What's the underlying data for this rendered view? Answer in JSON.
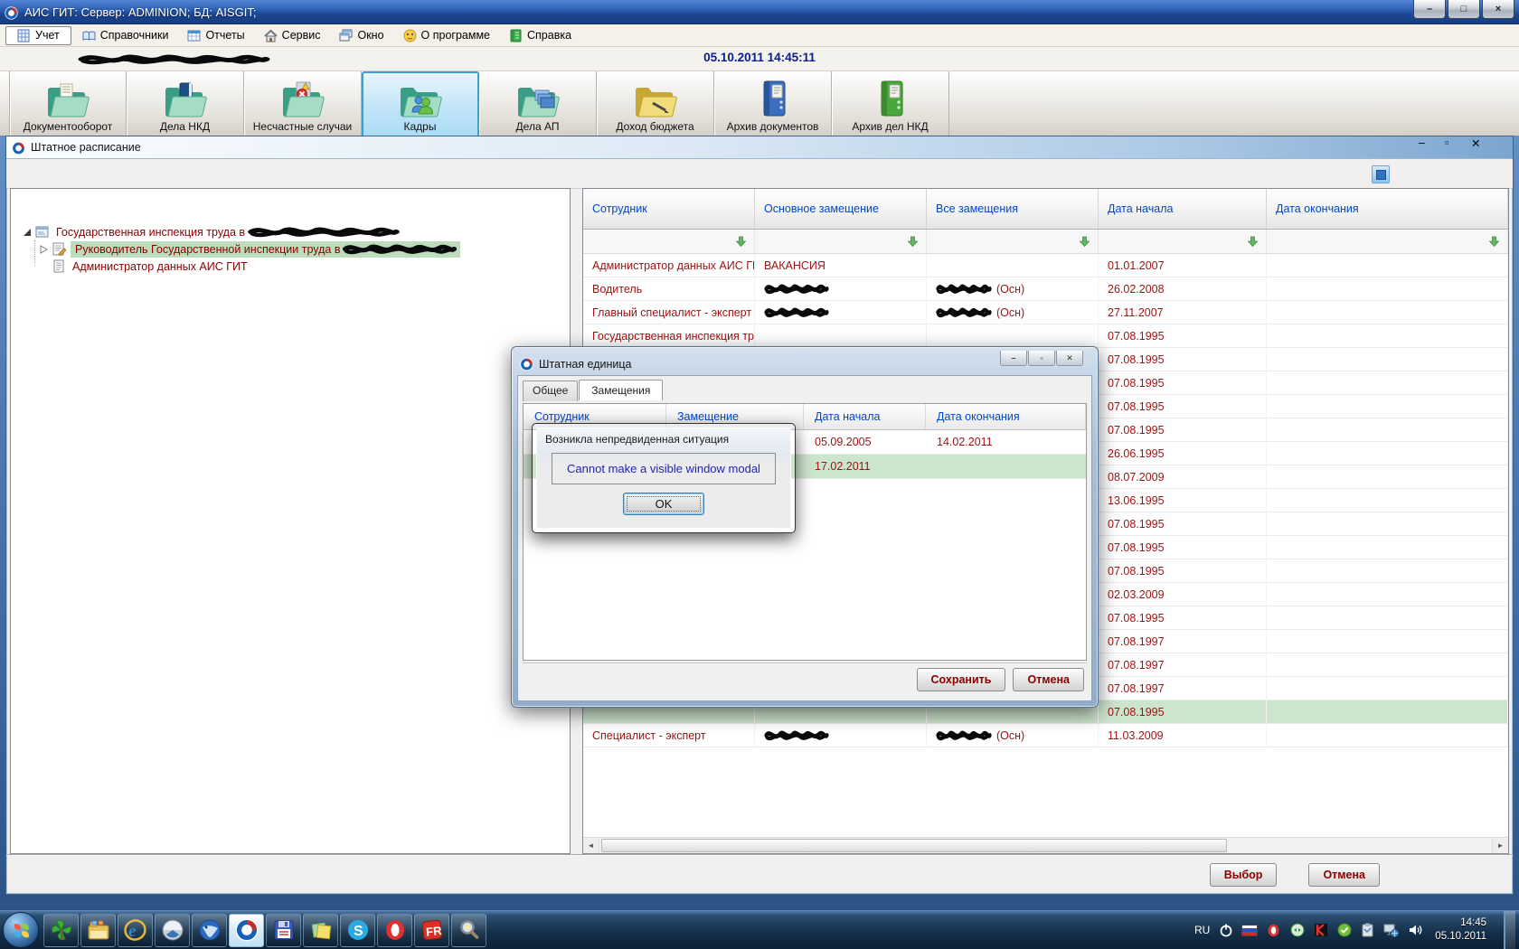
{
  "window": {
    "title": "АИС ГИТ:  Сервер: ADMINION;   БД: AISGIT;",
    "controls": {
      "minimize": "–",
      "maximize": "□",
      "close": "×"
    }
  },
  "menu": {
    "items": [
      {
        "label": "Учет",
        "icon": "ledger-icon"
      },
      {
        "label": "Справочники",
        "icon": "book-icon"
      },
      {
        "label": "Отчеты",
        "icon": "report-icon"
      },
      {
        "label": "Сервис",
        "icon": "home-icon"
      },
      {
        "label": "Окно",
        "icon": "windows-icon"
      },
      {
        "label": "О программе",
        "icon": "about-icon"
      },
      {
        "label": "Справка",
        "icon": "help-icon"
      }
    ]
  },
  "infobar": {
    "datetime": "05.10.2011  14:45:11"
  },
  "toolbar": {
    "items": [
      {
        "label": "Документооборот",
        "icon": "folder-documents-icon"
      },
      {
        "label": "Дела НКД",
        "icon": "folder-book-icon"
      },
      {
        "label": "Несчастные случаи",
        "icon": "folder-accident-icon"
      },
      {
        "label": "Кадры",
        "icon": "folder-people-icon",
        "selected": true
      },
      {
        "label": "Дела АП",
        "icon": "folder-cases-icon"
      },
      {
        "label": "Доход бюджета",
        "icon": "folder-budget-icon"
      },
      {
        "label": "Архив документов",
        "icon": "binder-blue-icon"
      },
      {
        "label": "Архив дел НКД",
        "icon": "binder-green-icon"
      }
    ]
  },
  "schedule_window": {
    "title": "Штатное расписание",
    "tree": {
      "items": [
        {
          "label": "Государственная инспекция труда в",
          "redacted_suffix": true,
          "expanded": true
        },
        {
          "label": "Руководитель Государственной инспекции труда в",
          "redacted_suffix": true,
          "selected": true
        },
        {
          "label": "Администратор данных АИС ГИТ"
        }
      ]
    },
    "table": {
      "columns": [
        "Сотрудник",
        "Основное замещение",
        "Все замещения",
        "Дата начала",
        "Дата окончания"
      ],
      "rows": [
        {
          "employee": "Администратор данных АИС ГИТ",
          "main": "ВАКАНСИЯ",
          "all": "",
          "start": "01.01.2007",
          "end": ""
        },
        {
          "employee": "Водитель",
          "redact_main": true,
          "redact_all": true,
          "all": "(Осн)",
          "start": "26.02.2008",
          "end": ""
        },
        {
          "employee": "Главный специалист - эксперт",
          "redact_main": true,
          "redact_all": true,
          "all": "(Осн)",
          "start": "27.11.2007",
          "end": ""
        },
        {
          "employee": "Государственная инспекция тру",
          "start": "07.08.1995",
          "end": ""
        },
        {
          "start": "07.08.1995"
        },
        {
          "start": "07.08.1995"
        },
        {
          "start": "07.08.1995"
        },
        {
          "start": "07.08.1995"
        },
        {
          "start": "26.06.1995"
        },
        {
          "start": "08.07.2009"
        },
        {
          "start": "13.06.1995"
        },
        {
          "start": "07.08.1995"
        },
        {
          "start": "07.08.1995"
        },
        {
          "start": "07.08.1995"
        },
        {
          "start": "02.03.2009"
        },
        {
          "start": "07.08.1995"
        },
        {
          "start": "07.08.1997"
        },
        {
          "start": "07.08.1997"
        },
        {
          "start": "07.08.1997"
        },
        {
          "start": "07.08.1995",
          "highlighted": true
        },
        {
          "employee": "Специалист - эксперт",
          "redact_main": true,
          "redact_all": true,
          "all": "(Осн)",
          "start": "11.03.2009"
        }
      ]
    },
    "buttons": [
      "Выбор",
      "Отмена"
    ]
  },
  "unit_dialog": {
    "title": "Штатная единица",
    "tabs": [
      {
        "label": "Общее"
      },
      {
        "label": "Замещения",
        "active": true
      }
    ],
    "table": {
      "columns": [
        "Сотрудник",
        "Замещение",
        "Дата начала",
        "Дата окончания"
      ],
      "rows": [
        {
          "start": "05.09.2005",
          "end": "14.02.2011"
        },
        {
          "start": "17.02.2011",
          "end": "",
          "highlighted": true
        }
      ]
    },
    "buttons": [
      "Сохранить",
      "Отмена"
    ]
  },
  "error_dialog": {
    "title": "Возникла непредвиденная ситуация",
    "message": "Cannot make a visible window modal",
    "ok_label": "OK"
  },
  "taskbar": {
    "icons": [
      "start",
      "green-utility",
      "file-manager",
      "internet-explorer",
      "browser-orb",
      "thunderbird",
      "ais-git",
      "save-tool",
      "sticky-notes",
      "skype",
      "opera",
      "fastreport",
      "search-tool"
    ],
    "tray": {
      "lang": "RU",
      "icons": [
        "power",
        "ru-flag",
        "opera",
        "disc-tool",
        "kaspersky",
        "agent",
        "clipboard",
        "network",
        "volume"
      ],
      "time": "14:45",
      "date": "05.10.2011"
    }
  }
}
